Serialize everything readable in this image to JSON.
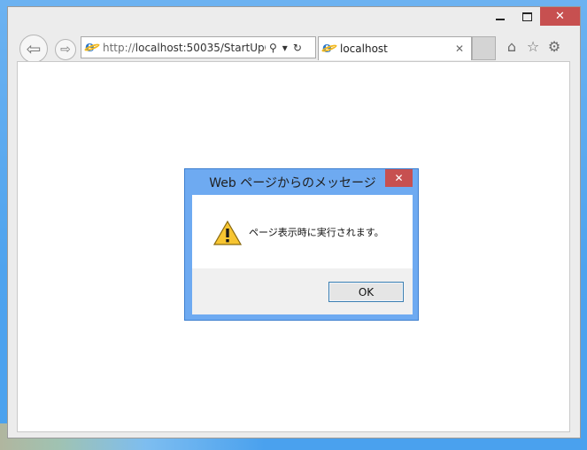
{
  "browser": {
    "window_controls": {
      "minimize": "_",
      "maximize": "□",
      "close": "✕"
    },
    "nav": {
      "back_icon": "back-arrow-icon",
      "forward_icon": "forward-arrow-icon"
    },
    "address_bar": {
      "url_scheme": "http://",
      "url_rest": "localhost:50035/StartUpC",
      "search_glyph": "⚲",
      "dropdown_glyph": "▾",
      "refresh_glyph": "↻"
    },
    "tab": {
      "title": "localhost",
      "close_glyph": "✕"
    },
    "toolbar_icons": {
      "home": "⌂",
      "favorites": "☆",
      "settings": "⚙"
    }
  },
  "dialog": {
    "title": "Web ページからのメッセージ",
    "close_glyph": "✕",
    "message": "ページ表示時に実行されます。",
    "ok_label": "OK",
    "icon": "warning-icon"
  }
}
